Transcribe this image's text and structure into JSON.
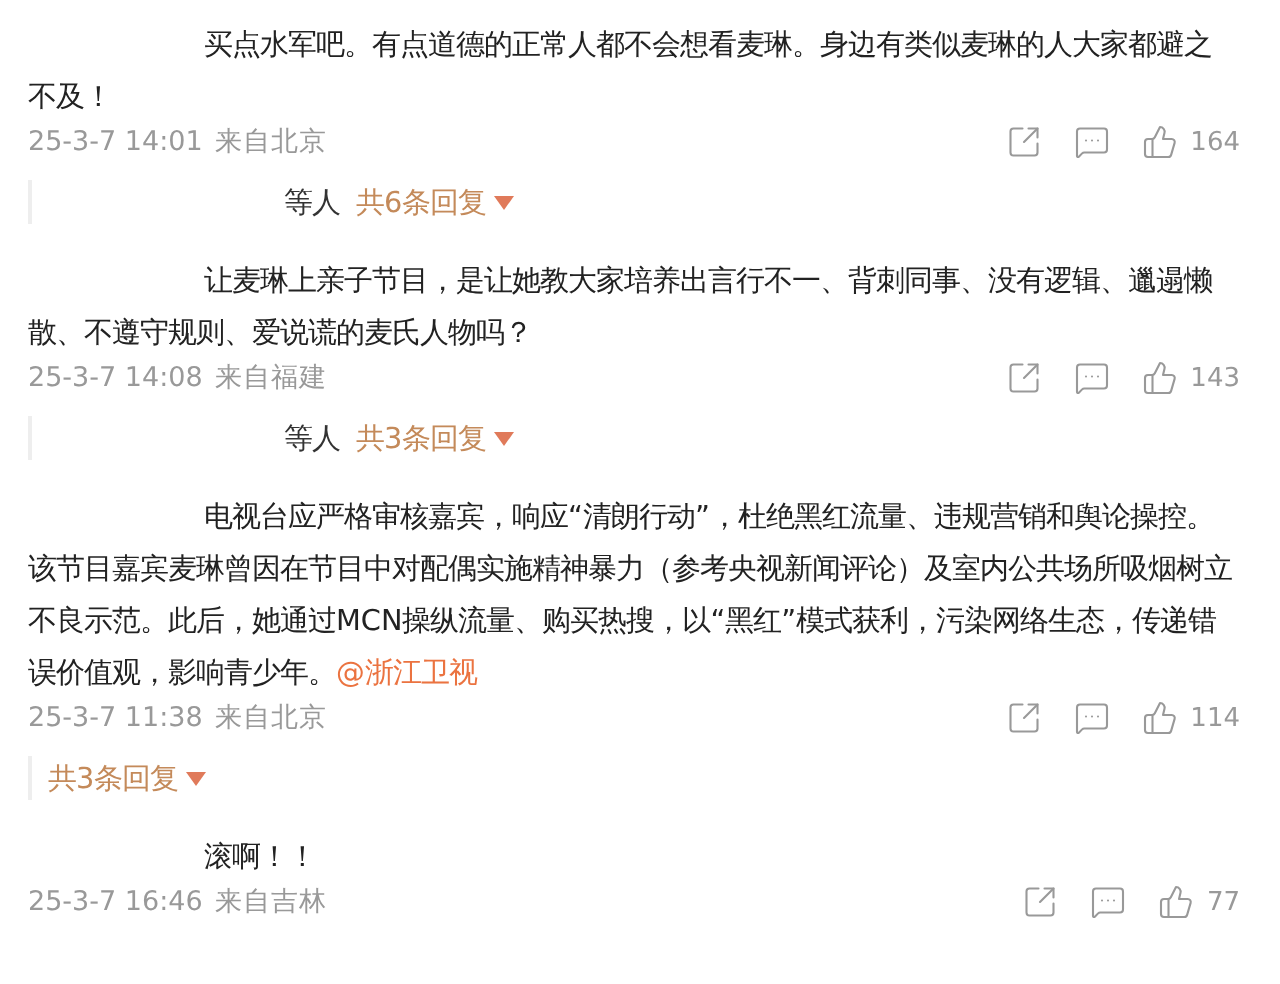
{
  "comments": [
    {
      "text": "买点水军吧。有点道德的正常人都不会想看麦琳。身边有类似麦琳的人大家都避之不及！",
      "time": "25-3-7 14:01",
      "source": "来自北京",
      "likes": "164",
      "replies": {
        "others": "等人",
        "label": "共6条回复"
      }
    },
    {
      "text": "让麦琳上亲子节目，是让她教大家培养出言行不一、背刺同事、没有逻辑、邋遢懒散、不遵守规则、爱说谎的麦氏人物吗？",
      "time": "25-3-7 14:08",
      "source": "来自福建",
      "likes": "143",
      "replies": {
        "others": "等人",
        "label": "共3条回复"
      }
    },
    {
      "text": "电视台应严格审核嘉宾，响应“清朗行动”，杜绝黑红流量、违规营销和舆论操控。该节目嘉宾麦琳曾因在节目中对配偶实施精神暴力（参考央视新闻评论）及室内公共场所吸烟树立不良示范。此后，她通过MCN操纵流量、购买热搜，以“黑红”模式获利，污染网络生态，传递错误价值观，影响青少年。",
      "mention": "@浙江卫视",
      "time": "25-3-7 11:38",
      "source": "来自北京",
      "likes": "114",
      "replies": {
        "label": "共3条回复"
      }
    },
    {
      "text": "滚啊！！",
      "time": "25-3-7 16:46",
      "source": "来自吉林",
      "likes": "77"
    }
  ]
}
